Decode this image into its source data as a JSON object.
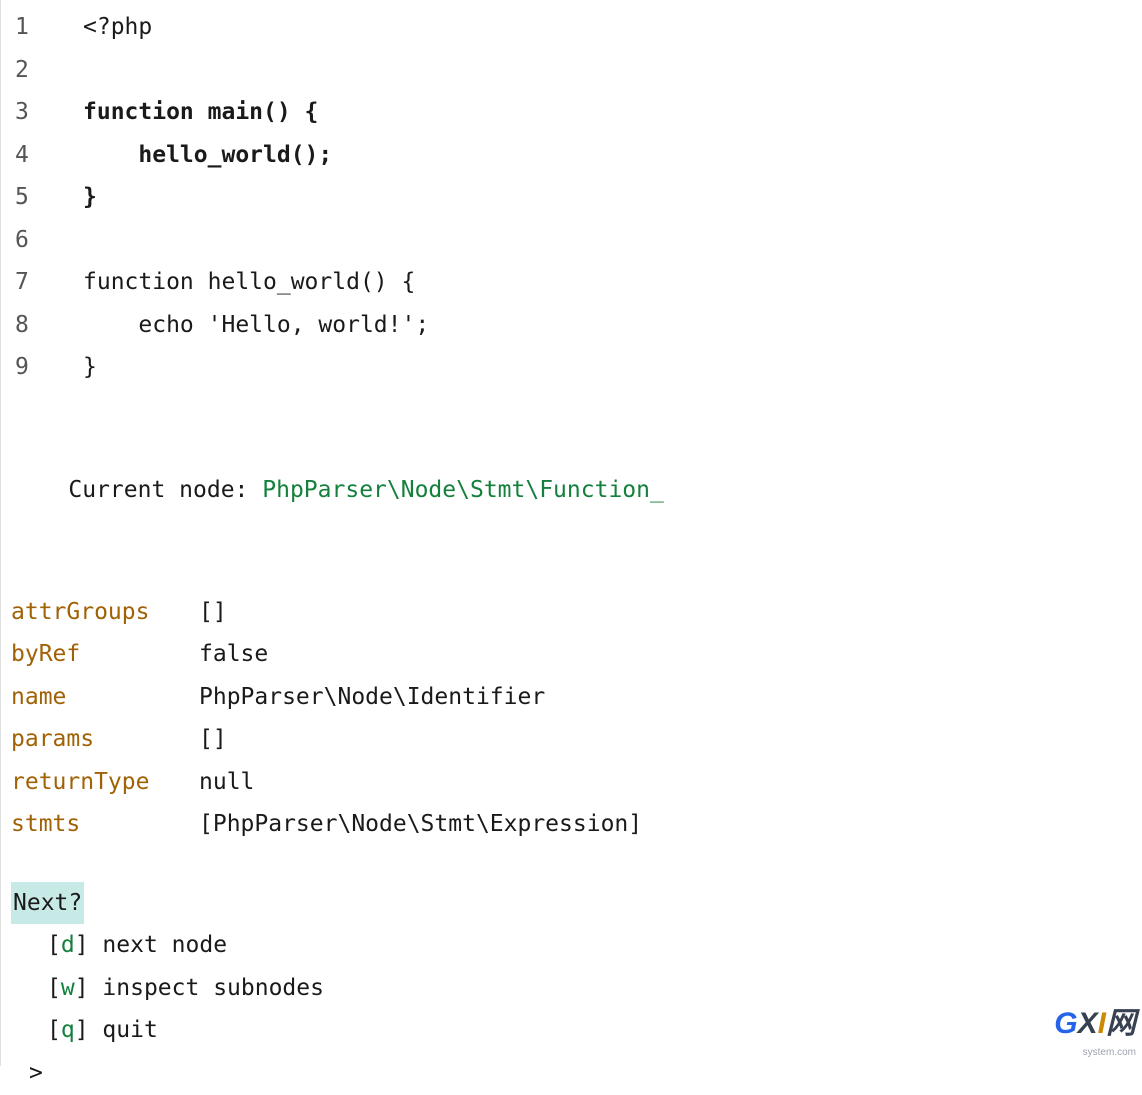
{
  "code": {
    "lines": [
      {
        "num": "1",
        "text": "<?php",
        "bold": false
      },
      {
        "num": "2",
        "text": "",
        "bold": false
      },
      {
        "num": "3",
        "text": "function main() {",
        "bold": true
      },
      {
        "num": "4",
        "text": "    hello_world();",
        "bold": true
      },
      {
        "num": "5",
        "text": "}",
        "bold": true
      },
      {
        "num": "6",
        "text": "",
        "bold": false
      },
      {
        "num": "7",
        "text": "function hello_world() {",
        "bold": false
      },
      {
        "num": "8",
        "text": "    echo 'Hello, world!';",
        "bold": false
      },
      {
        "num": "9",
        "text": "}",
        "bold": false
      }
    ]
  },
  "currentNode": {
    "label": "Current node: ",
    "value": "PhpParser\\Node\\Stmt\\Function_"
  },
  "props": [
    {
      "key": "attrGroups",
      "val": "[]"
    },
    {
      "key": "byRef",
      "val": "false"
    },
    {
      "key": "name",
      "val": "PhpParser\\Node\\Identifier"
    },
    {
      "key": "params",
      "val": "[]"
    },
    {
      "key": "returnType",
      "val": "null"
    },
    {
      "key": "stmts",
      "val": "[PhpParser\\Node\\Stmt\\Expression]"
    }
  ],
  "prompt": {
    "question": "Next?",
    "options": [
      {
        "key": "d",
        "desc": "next node"
      },
      {
        "key": "w",
        "desc": "inspect subnodes"
      },
      {
        "key": "q",
        "desc": "quit"
      }
    ],
    "cursor": ">"
  },
  "watermark": {
    "text": "GXI",
    "suffix": "网",
    "sub": "system.com"
  }
}
